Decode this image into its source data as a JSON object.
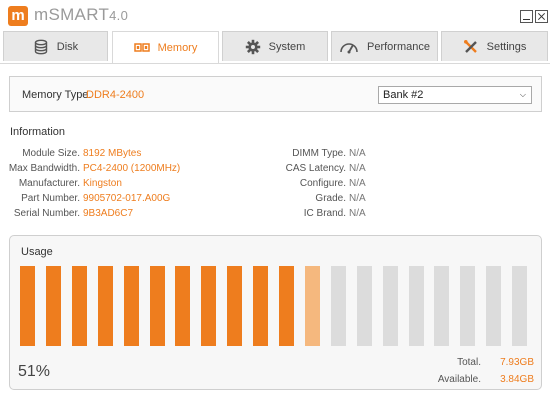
{
  "app": {
    "logo_letter": "m",
    "title": "mSMART",
    "version": "4.0"
  },
  "colors": {
    "accent": "#ee7d1e",
    "accent_light": "#f5b87e",
    "bar_empty": "#dcdcdc"
  },
  "tabs": [
    {
      "label": "Disk",
      "icon": "database-icon",
      "active": false
    },
    {
      "label": "Memory",
      "icon": "memory-icon",
      "active": true
    },
    {
      "label": "System",
      "icon": "gear-icon",
      "active": false
    },
    {
      "label": "Performance",
      "icon": "speedometer-icon",
      "active": false
    },
    {
      "label": "Settings",
      "icon": "tools-icon",
      "active": false
    }
  ],
  "memory_type": {
    "label": "Memory Type.",
    "value": "DDR4-2400",
    "bank_selected": "Bank #2"
  },
  "information": {
    "title": "Information",
    "left": [
      {
        "label": "Module Size.",
        "value": "8192 MBytes"
      },
      {
        "label": "Max Bandwidth.",
        "value": "PC4-2400 (1200MHz)"
      },
      {
        "label": "Manufacturer.",
        "value": "Kingston"
      },
      {
        "label": "Part Number.",
        "value": "9905702-017.A00G"
      },
      {
        "label": "Serial Number.",
        "value": "9B3AD6C7"
      }
    ],
    "right": [
      {
        "label": "DIMM Type.",
        "value": "N/A"
      },
      {
        "label": "CAS Latency.",
        "value": "N/A"
      },
      {
        "label": "Configure.",
        "value": "N/A"
      },
      {
        "label": "Grade.",
        "value": "N/A"
      },
      {
        "label": "IC Brand.",
        "value": "N/A"
      }
    ]
  },
  "usage": {
    "title": "Usage",
    "percent_label": "51%",
    "bars": {
      "total": 20,
      "full": 11,
      "partial": 1
    },
    "total_label": "Total.",
    "total_value": "7.93GB",
    "available_label": "Available.",
    "available_value": "3.84GB"
  }
}
